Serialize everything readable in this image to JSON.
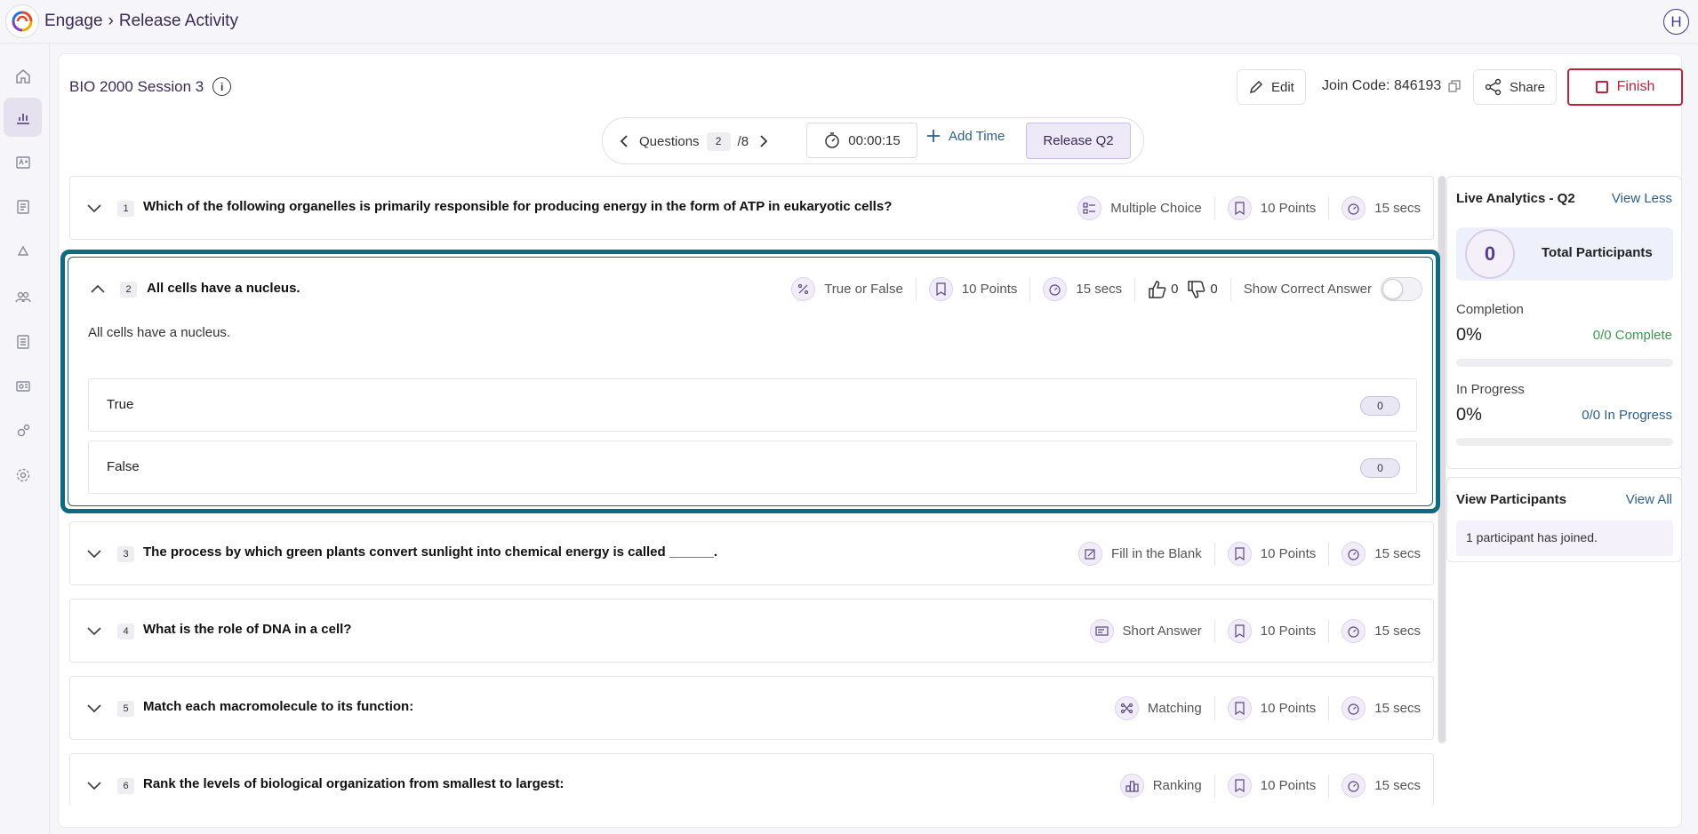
{
  "breadcrumb": {
    "app": "Engage",
    "page": "Release Activity"
  },
  "user": {
    "initial": "H"
  },
  "session": {
    "title": "BIO 2000 Session 3"
  },
  "header": {
    "edit_label": "Edit",
    "join_code_label": "Join Code: 846193",
    "share_label": "Share",
    "finish_label": "Finish"
  },
  "qnav": {
    "label": "Questions",
    "current": "2",
    "total": "/8",
    "timer": "00:00:15",
    "add_time": "Add Time",
    "release": "Release Q2"
  },
  "questions": [
    {
      "num": "1",
      "text": "Which of the following organelles is primarily responsible for producing energy in the form of ATP in eukaryotic cells?",
      "type": "Multiple Choice",
      "points": "10 Points",
      "time": "15 secs"
    },
    {
      "num": "2",
      "text": "All cells have a nucleus.",
      "type": "True or False",
      "points": "10 Points",
      "time": "15 secs",
      "likes": "0",
      "dislikes": "0",
      "show_correct": "Show Correct Answer",
      "body": "All cells have a nucleus.",
      "options": [
        {
          "label": "True",
          "count": "0"
        },
        {
          "label": "False",
          "count": "0"
        }
      ]
    },
    {
      "num": "3",
      "text": "The process by which green plants convert sunlight into chemical energy is called ______.",
      "type": "Fill in the Blank",
      "points": "10 Points",
      "time": "15 secs"
    },
    {
      "num": "4",
      "text": "What is the role of DNA in a cell?",
      "type": "Short Answer",
      "points": "10 Points",
      "time": "15 secs"
    },
    {
      "num": "5",
      "text": "Match each macromolecule to its function:",
      "type": "Matching",
      "points": "10 Points",
      "time": "15 secs"
    },
    {
      "num": "6",
      "text": "Rank the levels of biological organization from smallest to largest:",
      "type": "Ranking",
      "points": "10 Points",
      "time": "15 secs"
    }
  ],
  "analytics": {
    "title": "Live Analytics - Q2",
    "view_less": "View Less",
    "participants_count": "0",
    "participants_label": "Total Participants",
    "completion_label": "Completion",
    "completion_value": "0%",
    "completion_detail": "0/0 Complete",
    "progress_label": "In Progress",
    "progress_value": "0%",
    "progress_detail": "0/0 In Progress"
  },
  "participants": {
    "title": "View Participants",
    "view_all": "View All",
    "message": "1 participant has joined."
  },
  "colors": {
    "accent": "#0d6a7f",
    "finish": "#c0223a",
    "link": "#2b5f8f",
    "green": "#3a9a4f"
  }
}
